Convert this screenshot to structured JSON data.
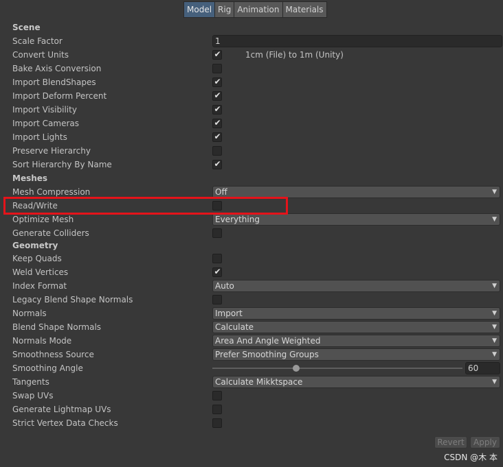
{
  "tabs": [
    {
      "label": "Model",
      "active": true
    },
    {
      "label": "Rig",
      "active": false
    },
    {
      "label": "Animation",
      "active": false
    },
    {
      "label": "Materials",
      "active": false
    }
  ],
  "scene": {
    "title": "Scene",
    "scale_factor": {
      "label": "Scale Factor",
      "value": "1"
    },
    "convert_units": {
      "label": "Convert Units",
      "checked": true,
      "note": "1cm (File) to 1m (Unity)"
    },
    "bake_axis_conversion": {
      "label": "Bake Axis Conversion",
      "checked": false
    },
    "import_blendshapes": {
      "label": "Import BlendShapes",
      "checked": true
    },
    "import_deform_percent": {
      "label": "Import Deform Percent",
      "checked": true
    },
    "import_visibility": {
      "label": "Import Visibility",
      "checked": true
    },
    "import_cameras": {
      "label": "Import Cameras",
      "checked": true
    },
    "import_lights": {
      "label": "Import Lights",
      "checked": true
    },
    "preserve_hierarchy": {
      "label": "Preserve Hierarchy",
      "checked": false
    },
    "sort_hierarchy": {
      "label": "Sort Hierarchy By Name",
      "checked": true
    }
  },
  "meshes": {
    "title": "Meshes",
    "mesh_compression": {
      "label": "Mesh Compression",
      "value": "Off"
    },
    "read_write": {
      "label": "Read/Write",
      "checked": false
    },
    "optimize_mesh": {
      "label": "Optimize Mesh",
      "value": "Everything"
    },
    "generate_colliders": {
      "label": "Generate Colliders",
      "checked": false
    }
  },
  "geometry": {
    "title": "Geometry",
    "keep_quads": {
      "label": "Keep Quads",
      "checked": false
    },
    "weld_vertices": {
      "label": "Weld Vertices",
      "checked": true
    },
    "index_format": {
      "label": "Index Format",
      "value": "Auto"
    },
    "legacy_blend_shape_normals": {
      "label": "Legacy Blend Shape Normals",
      "checked": false
    },
    "normals": {
      "label": "Normals",
      "value": "Import"
    },
    "blend_shape_normals": {
      "label": "Blend Shape Normals",
      "value": "Calculate"
    },
    "normals_mode": {
      "label": "Normals Mode",
      "value": "Area And Angle Weighted"
    },
    "smoothness_source": {
      "label": "Smoothness Source",
      "value": "Prefer Smoothing Groups"
    },
    "smoothing_angle": {
      "label": "Smoothing Angle",
      "value": "60",
      "min": 0,
      "max": 180
    },
    "tangents": {
      "label": "Tangents",
      "value": "Calculate Mikktspace"
    },
    "swap_uvs": {
      "label": "Swap UVs",
      "checked": false
    },
    "generate_lightmap_uvs": {
      "label": "Generate Lightmap UVs",
      "checked": false
    },
    "strict_vertex_data_checks": {
      "label": "Strict Vertex Data Checks",
      "checked": false
    }
  },
  "footer": {
    "revert_label": "Revert",
    "apply_label": "Apply"
  },
  "watermark": "CSDN @木 本",
  "colors": {
    "background": "#383838",
    "active_tab": "#46607c",
    "highlight_border": "#e5131a"
  },
  "icons": {
    "checkmark": "checkmark-icon",
    "dropdown": "chevron-down-icon"
  }
}
